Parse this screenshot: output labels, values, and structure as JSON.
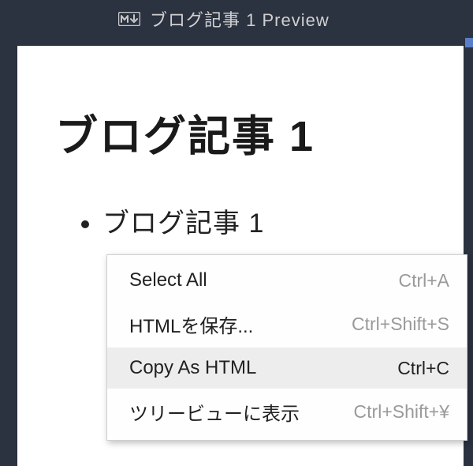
{
  "tab": {
    "icon": "markdown-icon",
    "title": "ブログ記事 1  Preview"
  },
  "content": {
    "heading": "ブログ記事 1",
    "list_item_1": "ブログ記事 1"
  },
  "menu": {
    "items": [
      {
        "label": "Select All",
        "shortcut": "Ctrl+A",
        "hovered": false
      },
      {
        "label": "HTMLを保存...",
        "shortcut": "Ctrl+Shift+S",
        "hovered": false
      },
      {
        "label": "Copy As HTML",
        "shortcut": "Ctrl+C",
        "hovered": true
      },
      {
        "label": "ツリービューに表示",
        "shortcut": "Ctrl+Shift+¥",
        "hovered": false
      }
    ]
  }
}
